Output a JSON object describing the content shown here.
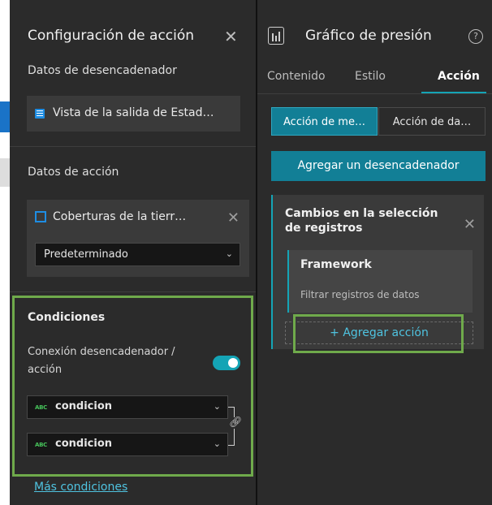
{
  "left_panel": {
    "title": "Configuración de acción",
    "close_icon": "close-icon",
    "trigger": {
      "section_label": "Datos de desencadenador",
      "source_label": "Vista de la salida de Estad…",
      "source_icon": "table-icon"
    },
    "action": {
      "section_label": "Datos de acción",
      "layer_label": "Coberturas de la tierr…",
      "layer_icon": "feature-layer-icon",
      "view_select_value": "Predeterminado"
    },
    "conditions": {
      "section_label": "Condiciones",
      "connection_label": "Conexión desencadenador / acción",
      "toggle_on": true,
      "field_1": "condicion",
      "field_2": "condicion",
      "field_type_badge": "ABC",
      "more_link": "Más condiciones"
    }
  },
  "right_panel": {
    "title": "Gráfico de presión",
    "help_glyph": "?",
    "tabs": [
      {
        "label": "Contenido",
        "active": false
      },
      {
        "label": "Estilo",
        "active": false
      },
      {
        "label": "Acción",
        "active": true
      }
    ],
    "segments": [
      {
        "label": "Acción de me…",
        "active": true
      },
      {
        "label": "Acción de da…",
        "active": false
      }
    ],
    "add_trigger_button": "Agregar un desencadenador",
    "trigger_card": {
      "title": "Cambios en la selección de registros",
      "framework": {
        "name": "Framework",
        "description": "Filtrar registros de datos"
      },
      "add_action_button": "+ Agregar acción"
    }
  },
  "colors": {
    "accent": "#14a4b5",
    "button": "#127f96",
    "highlight": "#6faa4b",
    "link": "#4fc3e0",
    "panel": "#2b2b2b"
  }
}
